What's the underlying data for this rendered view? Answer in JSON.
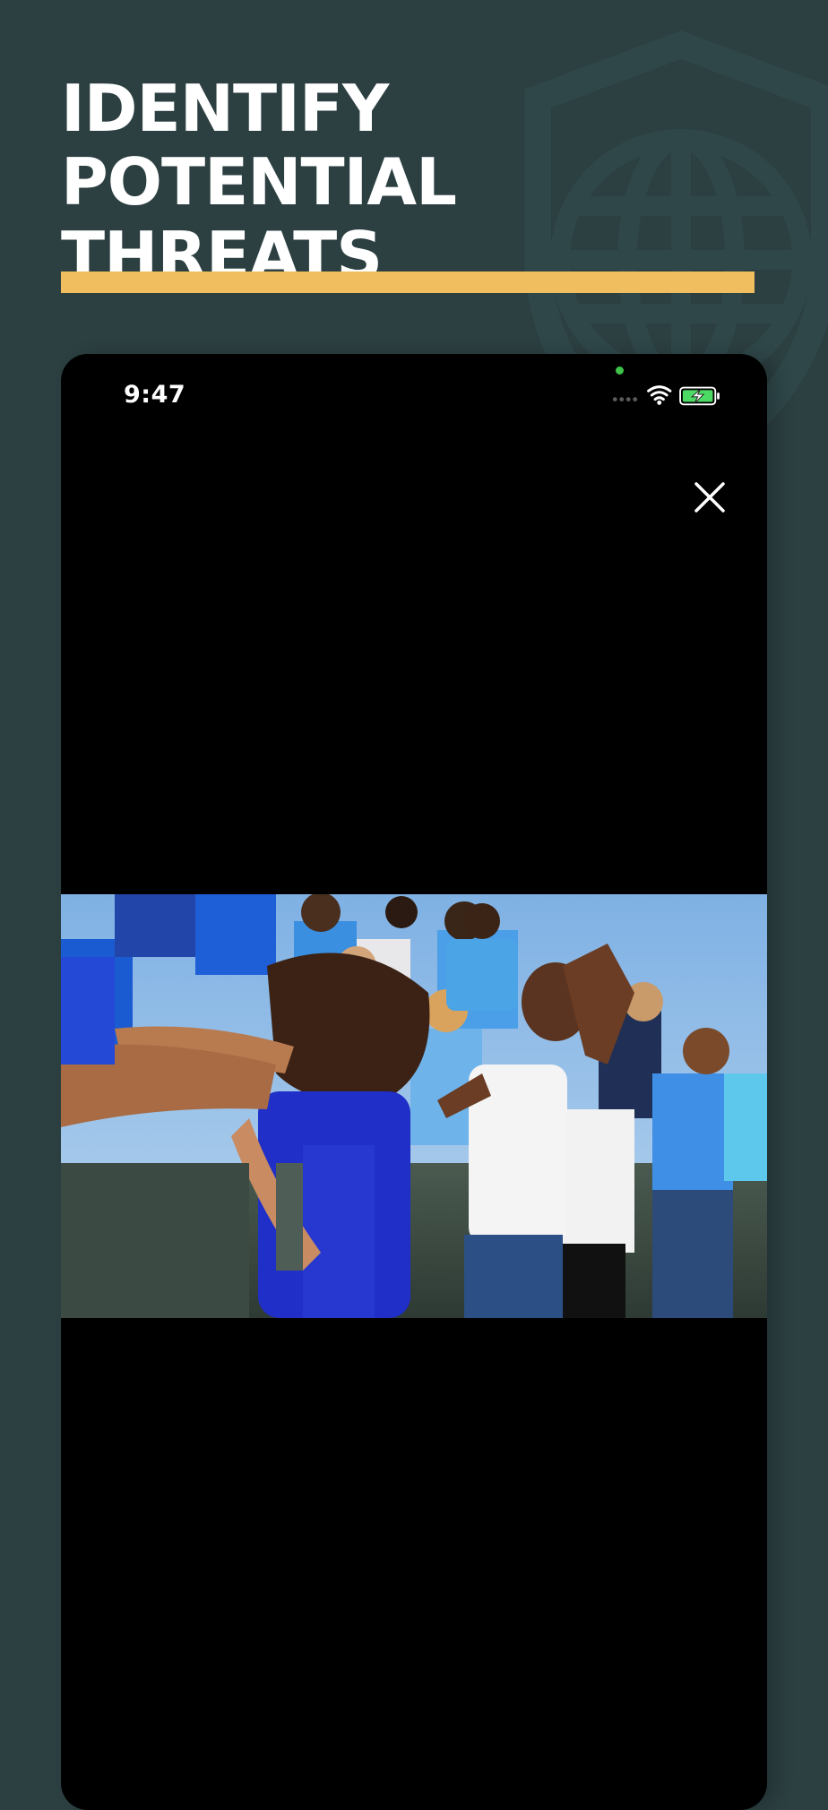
{
  "banner": {
    "headline_line1": "IDENTIFY POTENTIAL",
    "headline_line2": "THREATS",
    "accent_color": "#f0be5e",
    "background_color": "#2c3f41",
    "emblem_icon": "shield-globe-icon"
  },
  "phone": {
    "status_bar": {
      "time": "9:47",
      "camera_indicator_color": "#3ec24b",
      "signal_icon": "cellular-signal-icon",
      "wifi_icon": "wifi-icon",
      "battery_icon": "battery-charging-icon",
      "battery_color": "#4cd964"
    },
    "viewer": {
      "close_icon": "close-icon",
      "photo_description_icon": "crowd-photo"
    }
  }
}
